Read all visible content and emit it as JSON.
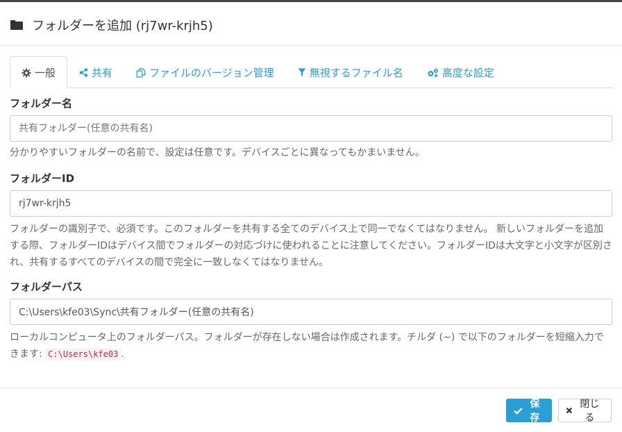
{
  "header": {
    "title": "フォルダーを追加 (rj7wr-krjh5)"
  },
  "tabs": [
    {
      "label": "一般",
      "icon": "gear-icon",
      "active": true
    },
    {
      "label": "共有",
      "icon": "share-icon",
      "active": false
    },
    {
      "label": "ファイルのバージョン管理",
      "icon": "copy-icon",
      "active": false
    },
    {
      "label": "無視するファイル名",
      "icon": "filter-icon",
      "active": false
    },
    {
      "label": "高度な設定",
      "icon": "gears-icon",
      "active": false
    }
  ],
  "form": {
    "folder_label": {
      "label": "フォルダー名",
      "value": "",
      "placeholder": "共有フォルダー(任意の共有名)",
      "help": "分かりやすいフォルダーの名前で、設定は任意です。デバイスごとに異なってもかまいません。"
    },
    "folder_id": {
      "label": "フォルダーID",
      "value": "rj7wr-krjh5",
      "help": "フォルダーの識別子で、必須です。このフォルダーを共有する全てのデバイス上で同一でなくてはなりません。 新しいフォルダーを追加する際、フォルダーIDはデバイス間でフォルダーの対応づけに使われることに注意してください。フォルダーIDは大文字と小文字が区別され、共有するすべてのデバイスの間で完全に一致しなくてはなりません。"
    },
    "folder_path": {
      "label": "フォルダーパス",
      "value": "C:\\Users\\kfe03\\Sync\\共有フォルダー(任意の共有名)",
      "help_prefix": "ローカルコンピュータ上のフォルダーパス。フォルダーが存在しない場合は作成されます。チルダ (~) で以下のフォルダーを短縮入力できます: ",
      "help_code": "C:\\Users\\kfe03",
      "help_suffix": "."
    }
  },
  "footer": {
    "save_label": "保存",
    "close_label": "閉じる"
  },
  "colors": {
    "accent": "#2a9fd6",
    "code_text": "#c7254e",
    "code_bg": "#f9f2f4"
  }
}
